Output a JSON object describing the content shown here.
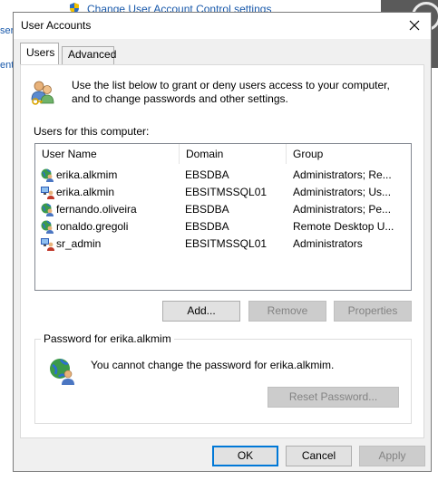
{
  "background": {
    "link": "Change User Account Control settings",
    "left_text_1": "ser",
    "left_text_2": "ent"
  },
  "dialog": {
    "title": "User Accounts",
    "tabs": [
      {
        "label": "Users",
        "active": true
      },
      {
        "label": "Advanced",
        "active": false
      }
    ],
    "intro": "Use the list below to grant or deny users access to your computer, and to change passwords and other settings.",
    "users_label": "Users for this computer:",
    "columns": [
      "User Name",
      "Domain",
      "Group"
    ],
    "users": [
      {
        "name": "erika.alkmim",
        "domain": "EBSDBA",
        "group": "Administrators; Re...",
        "icon": "domain-user-icon"
      },
      {
        "name": "erika.alkmin",
        "domain": "EBSITMSSQL01",
        "group": "Administrators; Us...",
        "icon": "local-user-icon"
      },
      {
        "name": "fernando.oliveira",
        "domain": "EBSDBA",
        "group": "Administrators; Pe...",
        "icon": "domain-user-icon"
      },
      {
        "name": "ronaldo.gregoli",
        "domain": "EBSDBA",
        "group": "Remote Desktop U...",
        "icon": "domain-user-icon"
      },
      {
        "name": "sr_admin",
        "domain": "EBSITMSSQL01",
        "group": "Administrators",
        "icon": "local-user-icon"
      }
    ],
    "buttons": {
      "add": "Add...",
      "remove": "Remove",
      "properties": "Properties",
      "reset_password": "Reset Password...",
      "ok": "OK",
      "cancel": "Cancel",
      "apply": "Apply"
    },
    "password_group_label": "Password for erika.alkmim",
    "password_message": "You cannot change the password for erika.alkmim."
  },
  "colors": {
    "accent": "#0078d7",
    "link": "#1a5aab",
    "dialog_bg": "#f0f0f0"
  }
}
